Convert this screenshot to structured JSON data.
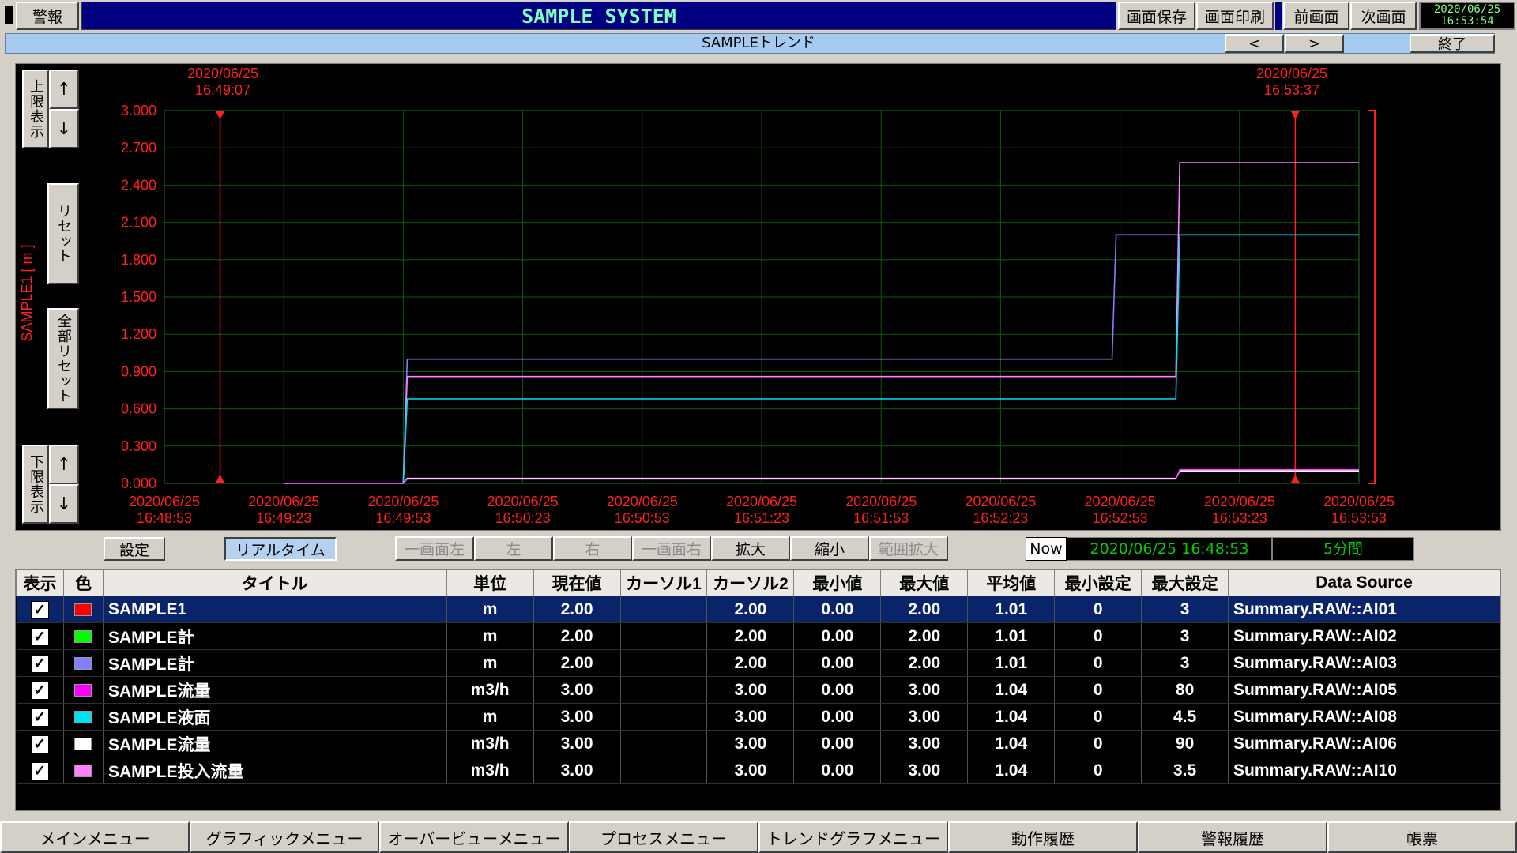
{
  "header": {
    "alarm_btn": "警報",
    "system_title": "SAMPLE SYSTEM",
    "buttons": [
      "画面保存",
      "画面印刷",
      "前画面",
      "次画面"
    ],
    "clock_date": "2020/06/25",
    "clock_time": "16:53:54",
    "title_color": "#80ffc0"
  },
  "subheader": {
    "title": "SAMPLEトレンド",
    "prev_label": "<",
    "next_label": ">",
    "exit_label": "終了"
  },
  "left_controls": {
    "upper_label": "上限表示",
    "reset_label": "リセット",
    "all_reset_label": "全部リセット",
    "lower_label": "下限表示",
    "up_arrow": "↑",
    "down_arrow": "↓"
  },
  "cursors": {
    "left": {
      "date": "2020/06/25",
      "time": "16:49:07"
    },
    "right": {
      "date": "2020/06/25",
      "time": "16:53:37"
    }
  },
  "chart_data": {
    "type": "line",
    "ylabel": "SAMPLE1 [ m ]",
    "ylim": [
      0,
      3
    ],
    "y_ticks": [
      "3.000",
      "2.700",
      "2.400",
      "2.100",
      "1.800",
      "1.500",
      "1.200",
      "0.900",
      "0.600",
      "0.300",
      "0.000"
    ],
    "x_ticks": [
      {
        "date": "2020/06/25",
        "time": "16:48:53"
      },
      {
        "date": "2020/06/25",
        "time": "16:49:23"
      },
      {
        "date": "2020/06/25",
        "time": "16:49:53"
      },
      {
        "date": "2020/06/25",
        "time": "16:50:23"
      },
      {
        "date": "2020/06/25",
        "time": "16:50:53"
      },
      {
        "date": "2020/06/25",
        "time": "16:51:23"
      },
      {
        "date": "2020/06/25",
        "time": "16:51:53"
      },
      {
        "date": "2020/06/25",
        "time": "16:52:23"
      },
      {
        "date": "2020/06/25",
        "time": "16:52:53"
      },
      {
        "date": "2020/06/25",
        "time": "16:53:23"
      },
      {
        "date": "2020/06/25",
        "time": "16:53:53"
      }
    ],
    "x_start": "16:48:53",
    "x_end": "16:53:53",
    "cursor_times": [
      "16:49:07",
      "16:53:37"
    ],
    "grid": true,
    "series": [
      {
        "color": "#8080ff",
        "points": [
          [
            "16:49:23",
            0.0
          ],
          [
            "16:49:53",
            0.0
          ],
          [
            "16:49:54",
            1.0
          ],
          [
            "16:52:51",
            1.0
          ],
          [
            "16:52:52",
            2.0
          ],
          [
            "16:53:53",
            2.0
          ]
        ]
      },
      {
        "color": "#ff80ff",
        "points": [
          [
            "16:49:23",
            0.0
          ],
          [
            "16:49:53",
            0.0
          ],
          [
            "16:49:54",
            0.86
          ],
          [
            "16:53:07",
            0.86
          ],
          [
            "16:53:08",
            2.58
          ],
          [
            "16:53:53",
            2.58
          ]
        ]
      },
      {
        "color": "#00e0f0",
        "points": [
          [
            "16:49:53",
            0.0
          ],
          [
            "16:49:54",
            0.68
          ],
          [
            "16:53:07",
            0.68
          ],
          [
            "16:53:08",
            2.0
          ],
          [
            "16:53:53",
            2.0
          ]
        ]
      },
      {
        "color": "#ffffff",
        "points": [
          [
            "16:49:53",
            0.0
          ],
          [
            "16:49:54",
            0.04
          ],
          [
            "16:53:07",
            0.04
          ],
          [
            "16:53:08",
            0.1
          ],
          [
            "16:53:53",
            0.1
          ]
        ]
      },
      {
        "color": "#ff40ff",
        "points": [
          [
            "16:49:23",
            0.0
          ],
          [
            "16:49:53",
            0.0
          ],
          [
            "16:49:54",
            0.035
          ],
          [
            "16:53:07",
            0.035
          ],
          [
            "16:53:08",
            0.11
          ],
          [
            "16:53:53",
            0.11
          ]
        ]
      }
    ]
  },
  "toolbar": {
    "settings": "設定",
    "realtime": "リアルタイム",
    "nav": [
      "一画面左",
      "左",
      "右",
      "一画面右",
      "拡大",
      "縮小",
      "範囲拡大"
    ],
    "nav_disabled": [
      true,
      true,
      true,
      true,
      false,
      false,
      true
    ],
    "now_label": "Now",
    "start_time": "2020/06/25 16:48:53",
    "span": "5分間"
  },
  "table": {
    "headers": [
      "表示",
      "色",
      "タイトル",
      "単位",
      "現在値",
      "カーソル1",
      "カーソル2",
      "最小値",
      "最大値",
      "平均値",
      "最小設定",
      "最大設定",
      "Data Source"
    ],
    "rows": [
      {
        "check": "✓",
        "color": "#ff0000",
        "title": "SAMPLE1",
        "unit": "m",
        "current": "2.00",
        "cursor1": "",
        "cursor2": "2.00",
        "min": "0.00",
        "max": "2.00",
        "avg": "1.01",
        "min_set": "0",
        "max_set": "3",
        "source": "Summary.RAW::AI01"
      },
      {
        "check": "✓",
        "color": "#00ff00",
        "title": "SAMPLE計",
        "unit": "m",
        "current": "2.00",
        "cursor1": "",
        "cursor2": "2.00",
        "min": "0.00",
        "max": "2.00",
        "avg": "1.01",
        "min_set": "0",
        "max_set": "3",
        "source": "Summary.RAW::AI02"
      },
      {
        "check": "✓",
        "color": "#8080ff",
        "title": "SAMPLE計",
        "unit": "m",
        "current": "2.00",
        "cursor1": "",
        "cursor2": "2.00",
        "min": "0.00",
        "max": "2.00",
        "avg": "1.01",
        "min_set": "0",
        "max_set": "3",
        "source": "Summary.RAW::AI03"
      },
      {
        "check": "✓",
        "color": "#ff00ff",
        "title": "SAMPLE流量",
        "unit": "m3/h",
        "current": "3.00",
        "cursor1": "",
        "cursor2": "3.00",
        "min": "0.00",
        "max": "3.00",
        "avg": "1.04",
        "min_set": "0",
        "max_set": "80",
        "source": "Summary.RAW::AI05"
      },
      {
        "check": "✓",
        "color": "#00e0f0",
        "title": "SAMPLE液面",
        "unit": "m",
        "current": "3.00",
        "cursor1": "",
        "cursor2": "3.00",
        "min": "0.00",
        "max": "3.00",
        "avg": "1.04",
        "min_set": "0",
        "max_set": "4.5",
        "source": "Summary.RAW::AI08"
      },
      {
        "check": "✓",
        "color": "#ffffff",
        "title": "SAMPLE流量",
        "unit": "m3/h",
        "current": "3.00",
        "cursor1": "",
        "cursor2": "3.00",
        "min": "0.00",
        "max": "3.00",
        "avg": "1.04",
        "min_set": "0",
        "max_set": "90",
        "source": "Summary.RAW::AI06"
      },
      {
        "check": "✓",
        "color": "#ff80ff",
        "title": "SAMPLE投入流量",
        "unit": "m3/h",
        "current": "3.00",
        "cursor1": "",
        "cursor2": "3.00",
        "min": "0.00",
        "max": "3.00",
        "avg": "1.04",
        "min_set": "0",
        "max_set": "3.5",
        "source": "Summary.RAW::AI10"
      }
    ]
  },
  "bottom_menu": [
    "メインメニュー",
    "グラフィックメニュー",
    "オーバービューメニュー",
    "プロセスメニュー",
    "トレンドグラフメニュー",
    "動作履歴",
    "警報履歴",
    "帳票"
  ]
}
